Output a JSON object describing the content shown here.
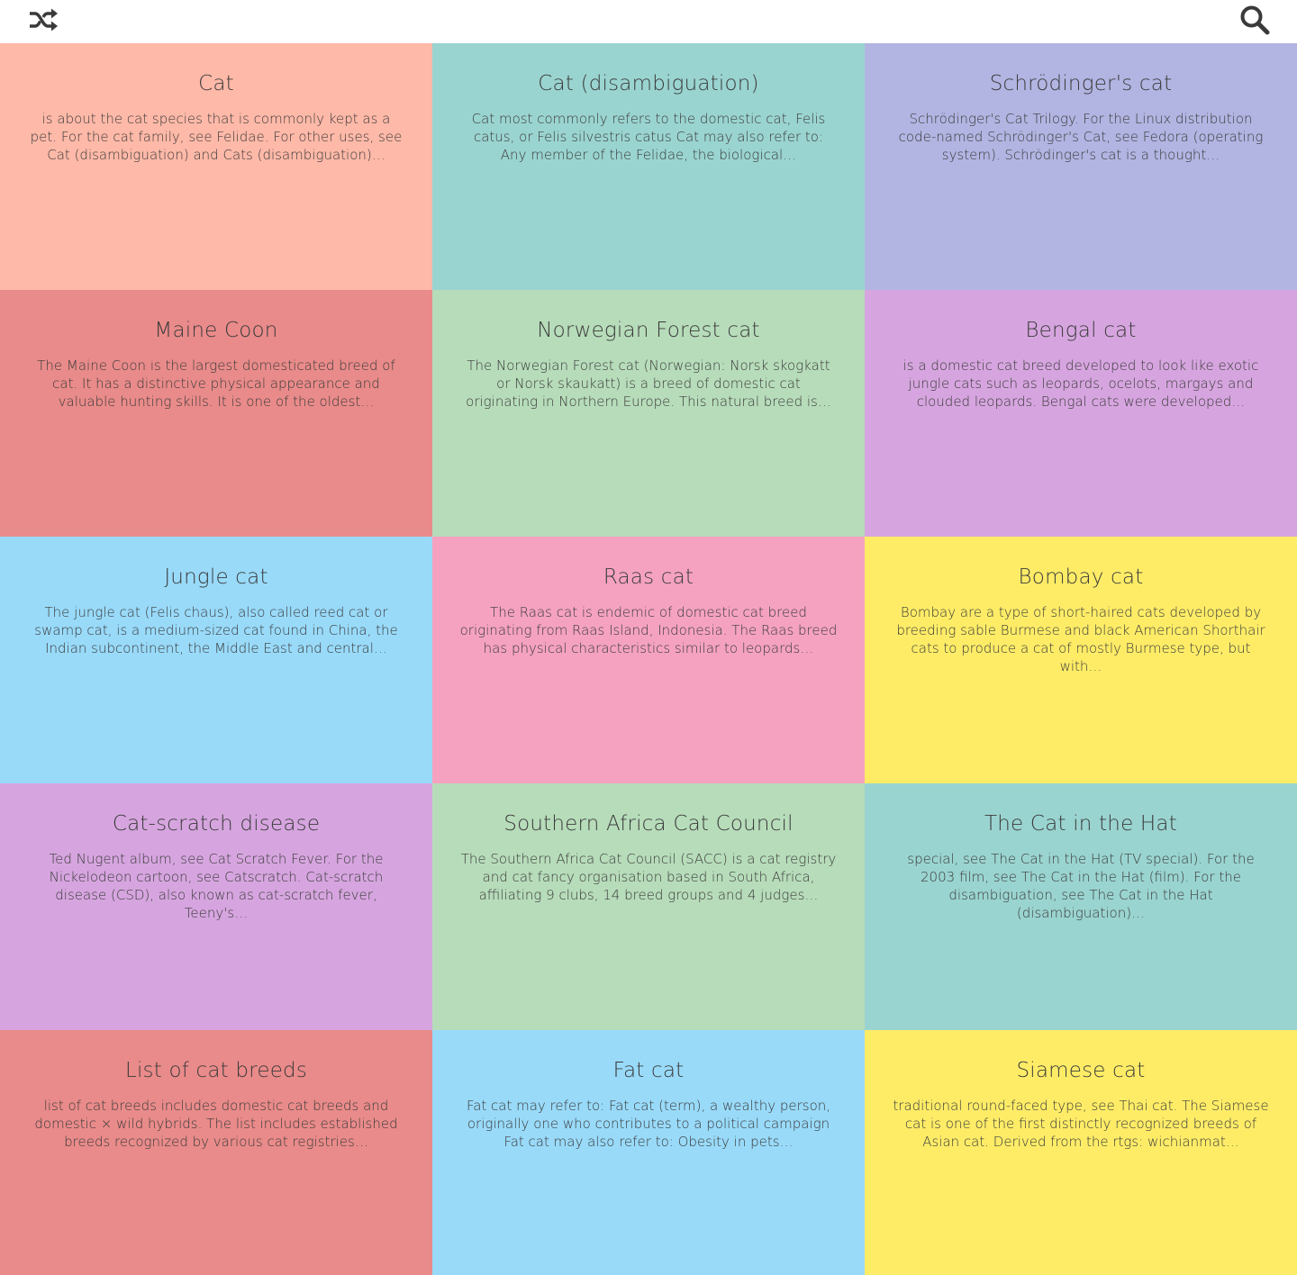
{
  "toolbar": {
    "shuffle_icon": "shuffle-icon",
    "search_icon": "search-icon"
  },
  "cards": [
    {
      "title": "Cat",
      "snippet": "is about the cat species that is commonly kept as a pet. For the cat family, see Felidae. For other uses, see Cat (disambiguation) and Cats (disambiguation)…",
      "color": "#FFB9A8"
    },
    {
      "title": "Cat (disambiguation)",
      "snippet": "Cat most commonly refers to the domestic cat, Felis catus, or Felis silvestris catus Cat may also refer to: Any member of the Felidae, the biological…",
      "color": "#9AD4D0"
    },
    {
      "title": "Schrödinger's cat",
      "snippet": "Schrödinger's Cat Trilogy. For the Linux distribution code-named Schrödinger's Cat, see Fedora (operating system). Schrödinger's cat is a thought…",
      "color": "#B2B5E2"
    },
    {
      "title": "Maine Coon",
      "snippet": "The Maine Coon is the largest domesticated breed of cat. It has a distinctive physical appearance and valuable hunting skills. It is one of the oldest…",
      "color": "#E98B8A"
    },
    {
      "title": "Norwegian Forest cat",
      "snippet": "The Norwegian Forest cat (Norwegian: Norsk skogkatt or Norsk skaukatt) is a breed of domestic cat originating in Northern Europe. This natural breed is…",
      "color": "#B7DCBA"
    },
    {
      "title": "Bengal cat",
      "snippet": "is a domestic cat breed developed to look like exotic jungle cats such as leopards, ocelots, margays and clouded leopards. Bengal cats were developed…",
      "color": "#D6A5DF"
    },
    {
      "title": "Jungle cat",
      "snippet": "The jungle cat (Felis chaus), also called reed cat or swamp cat, is a medium-sized cat found in China, the Indian subcontinent, the Middle East and central…",
      "color": "#99DAF9"
    },
    {
      "title": "Raas cat",
      "snippet": "The Raas cat is endemic of domestic cat breed originating from Raas Island, Indonesia. The Raas breed has physical characteristics similar to leopards…",
      "color": "#F5A2C1"
    },
    {
      "title": "Bombay cat",
      "snippet": "Bombay are a type of short-haired cats developed by breeding sable Burmese and black American Shorthair cats to produce a cat of mostly Burmese type, but with…",
      "color": "#FEEC67"
    },
    {
      "title": "Cat-scratch disease",
      "snippet": "Ted Nugent album, see Cat Scratch Fever. For the Nickelodeon cartoon, see Catscratch. Cat-scratch disease (CSD), also known as cat-scratch fever, Teeny's…",
      "color": "#D6A5DF"
    },
    {
      "title": "Southern Africa Cat Council",
      "snippet": "The Southern Africa Cat Council (SACC) is a cat registry and cat fancy organisation based in South Africa, affiliating 9 clubs, 14 breed groups and 4 judges…",
      "color": "#B7DCBA"
    },
    {
      "title": "The Cat in the Hat",
      "snippet": "special, see The Cat in the Hat (TV special). For the 2003 film, see The Cat in the Hat (film). For the disambiguation, see The Cat in the Hat (disambiguation)…",
      "color": "#9AD4D0"
    },
    {
      "title": "List of cat breeds",
      "snippet": "list of cat breeds includes domestic cat breeds and domestic × wild hybrids. The list includes established breeds recognized by various cat registries…",
      "color": "#E98B8A"
    },
    {
      "title": "Fat cat",
      "snippet": "Fat cat may refer to: Fat cat (term), a wealthy person, originally one who contributes to a political campaign Fat cat may also refer to: Obesity in pets…",
      "color": "#99DAF9"
    },
    {
      "title": "Siamese cat",
      "snippet": "traditional round-faced type, see Thai cat. The Siamese cat is one of the first distinctly recognized breeds of Asian cat. Derived from the rtgs: wichianmat…",
      "color": "#FEEC67"
    }
  ]
}
